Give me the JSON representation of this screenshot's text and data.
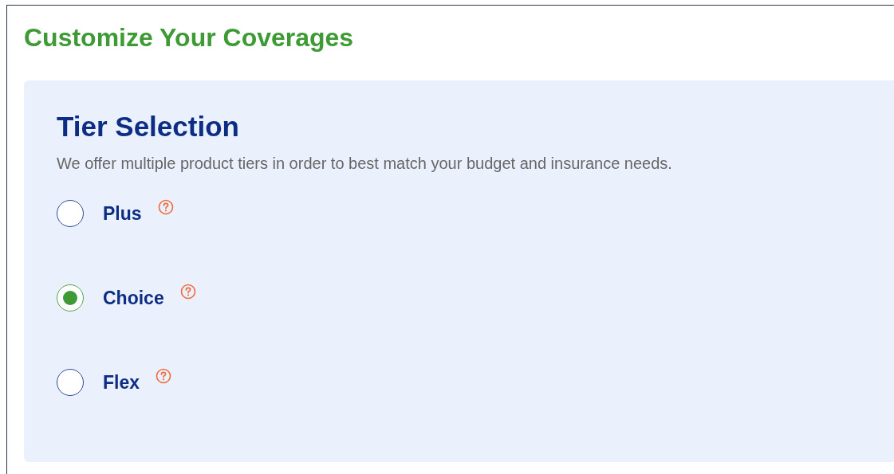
{
  "page_title": "Customize Your Coverages",
  "tier_section": {
    "title": "Tier Selection",
    "description": "We offer multiple product tiers in order to best match your budget and insurance needs.",
    "options": [
      {
        "label": "Plus",
        "selected": false
      },
      {
        "label": "Choice",
        "selected": true
      },
      {
        "label": "Flex",
        "selected": false
      }
    ]
  }
}
